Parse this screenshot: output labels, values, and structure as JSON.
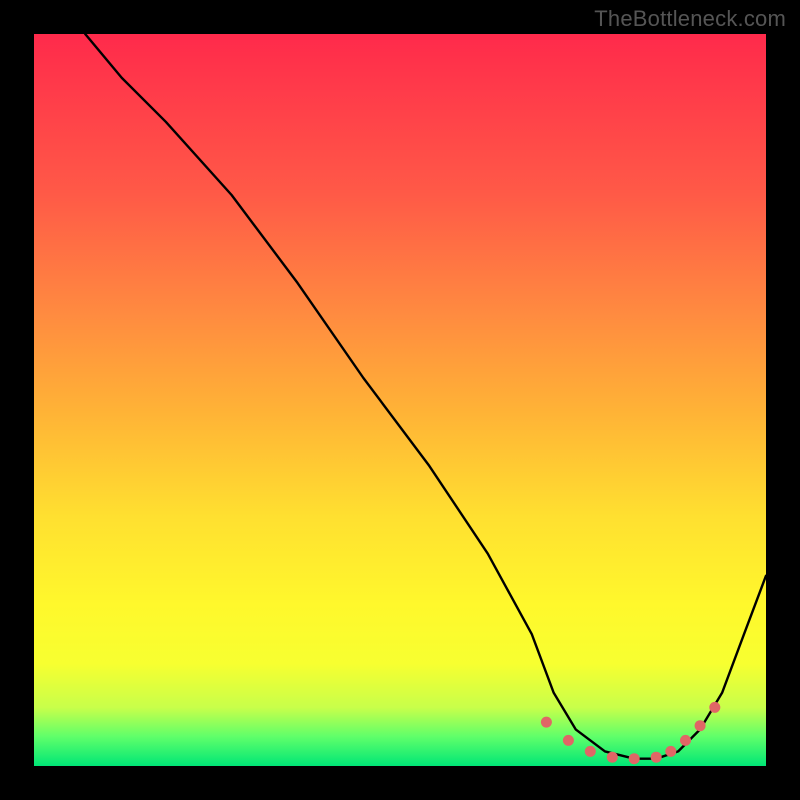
{
  "attribution": "TheBottleneck.com",
  "chart_data": {
    "type": "line",
    "title": "",
    "xlabel": "",
    "ylabel": "",
    "xlim": [
      0,
      100
    ],
    "ylim": [
      0,
      100
    ],
    "series": [
      {
        "name": "bottleneck-curve",
        "x": [
          7,
          12,
          18,
          27,
          36,
          45,
          54,
          62,
          68,
          71,
          74,
          78,
          82,
          85,
          88,
          91,
          94,
          97,
          100
        ],
        "values": [
          100,
          94,
          88,
          78,
          66,
          53,
          41,
          29,
          18,
          10,
          5,
          2,
          1,
          1,
          2,
          5,
          10,
          18,
          26
        ]
      }
    ],
    "markers": {
      "name": "valley-dots",
      "x": [
        70,
        73,
        76,
        79,
        82,
        85,
        87,
        89,
        91,
        93
      ],
      "values": [
        6.0,
        3.5,
        2.0,
        1.2,
        1.0,
        1.2,
        2.0,
        3.5,
        5.5,
        8.0
      ]
    },
    "gradient_stops": [
      {
        "pct": 0,
        "color": "#ff2a4b"
      },
      {
        "pct": 22,
        "color": "#ff5a47"
      },
      {
        "pct": 38,
        "color": "#ff8a40"
      },
      {
        "pct": 52,
        "color": "#ffb436"
      },
      {
        "pct": 66,
        "color": "#ffe030"
      },
      {
        "pct": 78,
        "color": "#fff82c"
      },
      {
        "pct": 86,
        "color": "#f7ff30"
      },
      {
        "pct": 92,
        "color": "#c8ff4a"
      },
      {
        "pct": 96,
        "color": "#5fff6a"
      },
      {
        "pct": 100,
        "color": "#00e676"
      }
    ]
  }
}
